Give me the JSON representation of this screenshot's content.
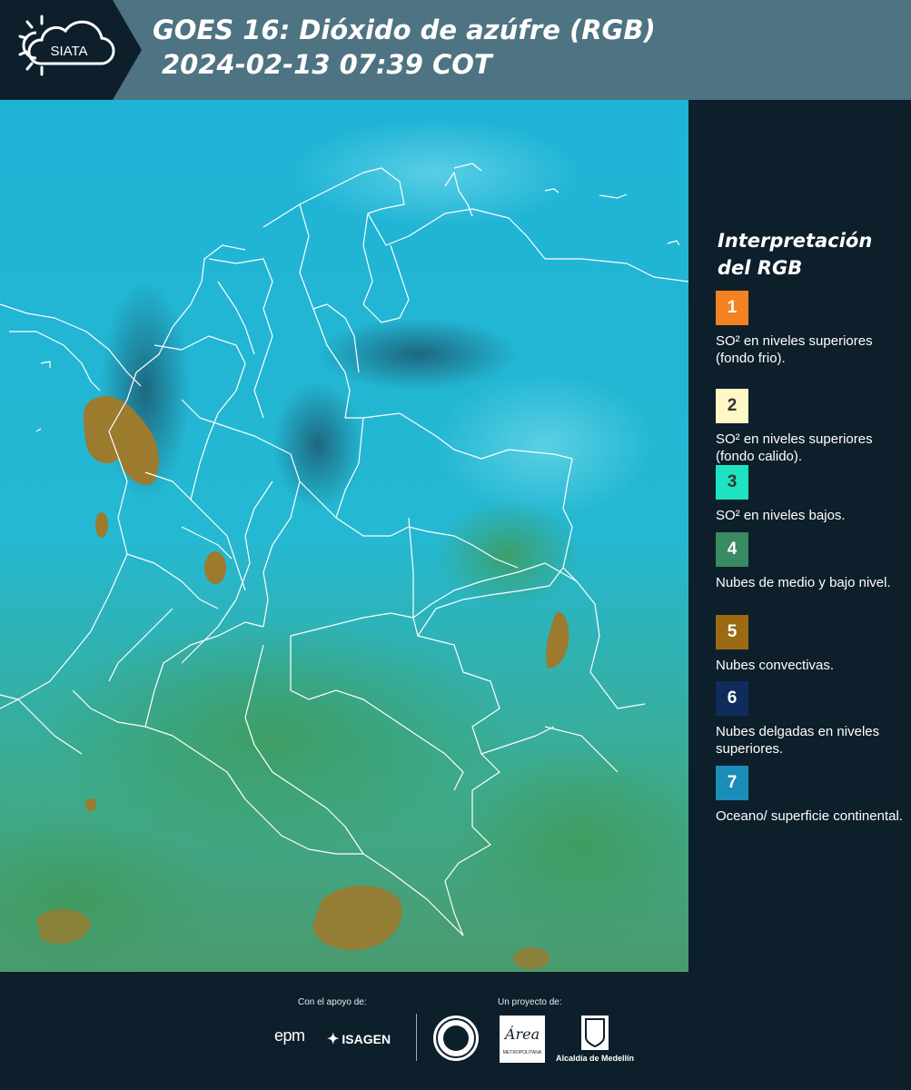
{
  "header": {
    "logo_text": "SIATA",
    "title_line1": "GOES 16: Dióxido de azúfre (RGB)",
    "title_line2": "2024-02-13 07:39 COT",
    "bg_color": "#4e7382"
  },
  "map": {
    "ocean_color": "#18a8cf",
    "land_color": "#2bbfd6",
    "convective_color": "#9c7a2e",
    "border_color": "#ffffff"
  },
  "legend": {
    "title": "Interpretación del RGB",
    "items": [
      {
        "number": "1",
        "text": "SO² en niveles superiores (fondo frio).",
        "color": "#f58220",
        "num_color": "#ffffff"
      },
      {
        "number": "2",
        "text": "SO² en niveles superiores (fondo calido).",
        "color": "#fff7c4",
        "num_color": "#333333"
      },
      {
        "number": "3",
        "text": "SO² en niveles bajos.",
        "color": "#1de3c3",
        "num_color": "#333333"
      },
      {
        "number": "4",
        "text": "Nubes de medio y bajo nivel.",
        "color": "#3a8a62",
        "num_color": "#ffffff"
      },
      {
        "number": "5",
        "text": "Nubes convectivas.",
        "color": "#9b6a12",
        "num_color": "#ffffff"
      },
      {
        "number": "6",
        "text": "Nubes delgadas en niveles superiores.",
        "color": "#0f2c5c",
        "num_color": "#ffffff"
      },
      {
        "number": "7",
        "text": "Oceano/ superficie continental.",
        "color": "#1c8db8",
        "num_color": "#ffffff"
      }
    ]
  },
  "footer": {
    "support_label": "Con el apoyo de:",
    "project_label": "Un proyecto de:",
    "epm_label": "epm",
    "isagen_label": "ISAGEN",
    "area_label": "Área",
    "area_sub": "METROPOLITANA",
    "alcaldia_label": "Alcaldía de Medellín"
  }
}
